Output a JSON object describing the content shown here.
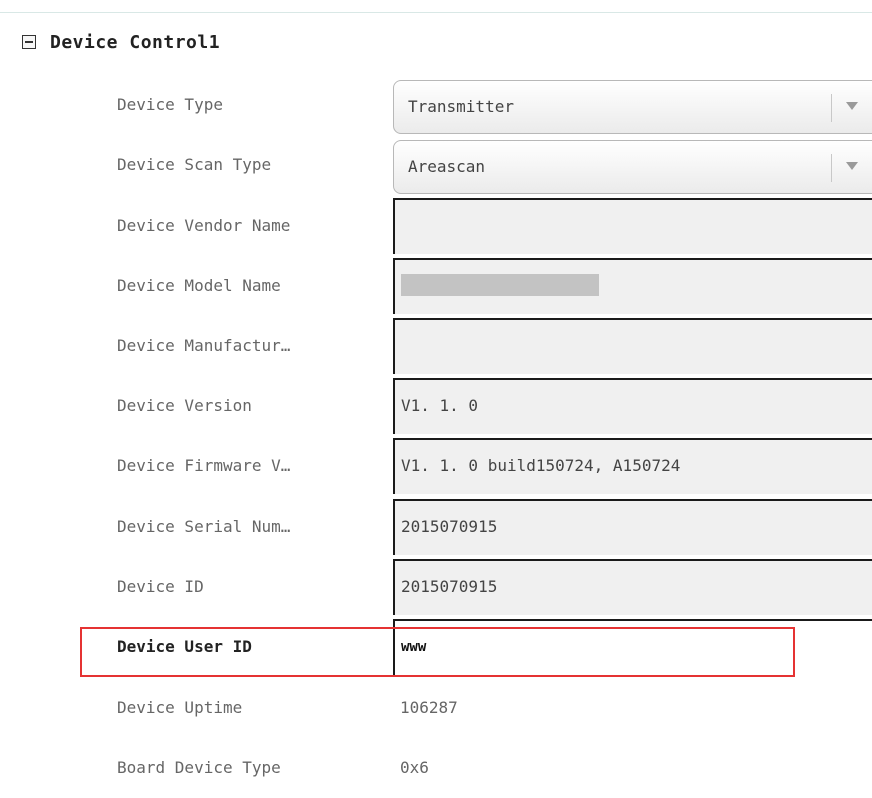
{
  "group": {
    "title": "Device Control1"
  },
  "rows": [
    {
      "label": "Device Type",
      "value": "Transmitter"
    },
    {
      "label": "Device Scan Type",
      "value": "Areascan"
    },
    {
      "label": "Device Vendor Name",
      "value": ""
    },
    {
      "label": "Device Model Name",
      "value": ""
    },
    {
      "label": "Device Manufactur…",
      "value": ""
    },
    {
      "label": "Device Version",
      "value": "V1. 1. 0"
    },
    {
      "label": "Device Firmware V…",
      "value": "V1. 1. 0 build150724, A150724"
    },
    {
      "label": "Device Serial Num…",
      "value": "2015070915"
    },
    {
      "label": "Device ID",
      "value": "2015070915"
    },
    {
      "label": "Device User ID",
      "value": "www"
    },
    {
      "label": "Device Uptime",
      "value": "106287"
    },
    {
      "label": "Board Device Type",
      "value": "0x6"
    }
  ],
  "colors": {
    "highlight_border": "#e53333",
    "field_background": "#f0f0f0"
  }
}
